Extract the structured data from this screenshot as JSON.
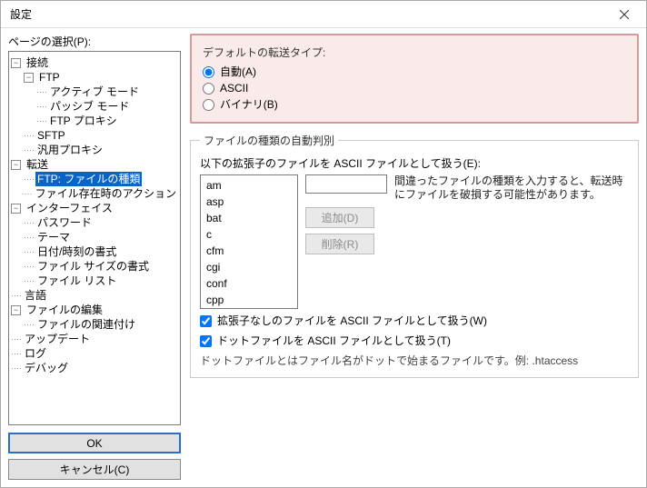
{
  "title": "設定",
  "left_label": "ページの選択(P):",
  "tree": {
    "connection": "接続",
    "ftp": "FTP",
    "active": "アクティブ モード",
    "passive": "パッシブ モード",
    "ftpproxy": "FTP プロキシ",
    "sftp": "SFTP",
    "genproxy": "汎用プロキシ",
    "transfer": "転送",
    "filetype": "FTP: ファイルの種類",
    "existaction": "ファイル存在時のアクション",
    "interface": "インターフェイス",
    "password": "パスワード",
    "theme": "テーマ",
    "datefmt": "日付/時刻の書式",
    "sizefmt": "ファイル サイズの書式",
    "filelist": "ファイル リスト",
    "language": "言語",
    "fileedit": "ファイルの編集",
    "assoc": "ファイルの関連付け",
    "update": "アップデート",
    "log": "ログ",
    "debug": "デバッグ"
  },
  "buttons": {
    "ok": "OK",
    "cancel": "キャンセル(C)"
  },
  "transfer_type": {
    "legend": "デフォルトの転送タイプ:",
    "auto": "自動(A)",
    "ascii": "ASCII",
    "binary": "バイナリ(B)"
  },
  "auto_group": {
    "legend": "ファイルの種類の自動判別",
    "label_exts": "以下の拡張子のファイルを ASCII ファイルとして扱う(E):",
    "warn": "間違ったファイルの種類を入力すると、転送時にファイルを破損する可能性があります。",
    "add": "追加(D)",
    "remove": "削除(R)",
    "chk_noext": "拡張子なしのファイルを ASCII ファイルとして扱う(W)",
    "chk_dot": "ドットファイルを ASCII ファイルとして扱う(T)",
    "note": "ドットファイルとはファイル名がドットで始まるファイルです。例: .htaccess",
    "exts": [
      "am",
      "asp",
      "bat",
      "c",
      "cfm",
      "cgi",
      "conf",
      "cpp"
    ]
  }
}
